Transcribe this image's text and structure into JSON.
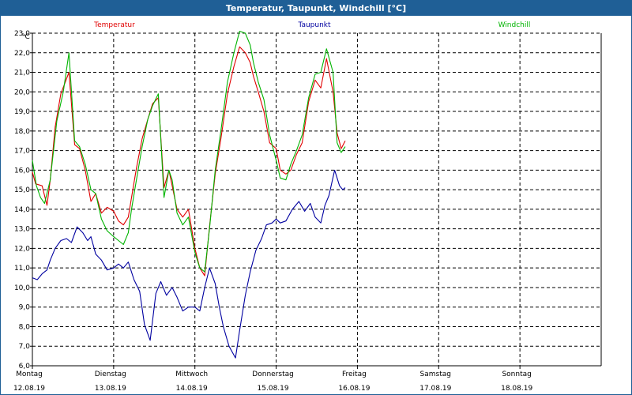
{
  "window": {
    "title": "Temperatur, Taupunkt, Windchill [°C]"
  },
  "chart_data": {
    "type": "line",
    "title": "Temperatur, Taupunkt, Windchill [°C]",
    "ylabel": "°C",
    "ylim": [
      6.0,
      23.0
    ],
    "ytick_step": 1.0,
    "xlim_days": [
      0,
      7
    ],
    "grid": true,
    "legend_placement": "top",
    "y_ticks": [
      "23,0",
      "22,0",
      "21,0",
      "20,0",
      "19,0",
      "18,0",
      "17,0",
      "16,0",
      "15,0",
      "14,0",
      "13,0",
      "12,0",
      "11,0",
      "10,0",
      "9,0",
      "8,0",
      "7,0",
      "6,0"
    ],
    "x_ticks": [
      {
        "day": "Montag",
        "date": "12.08.19"
      },
      {
        "day": "Dienstag",
        "date": "13.08.19"
      },
      {
        "day": "Mittwoch",
        "date": "14.08.19"
      },
      {
        "day": "Donnerstag",
        "date": "15.08.19"
      },
      {
        "day": "Freitag",
        "date": "16.08.19"
      },
      {
        "day": "Samstag",
        "date": "17.08.19"
      },
      {
        "day": "Sonntag",
        "date": "18.08.19"
      }
    ],
    "series": [
      {
        "name": "Temperatur",
        "color": "#e00000",
        "x": [
          0,
          0.04,
          0.12,
          0.18,
          0.22,
          0.28,
          0.35,
          0.45,
          0.52,
          0.58,
          0.65,
          0.72,
          0.78,
          0.85,
          0.92,
          1.0,
          1.06,
          1.12,
          1.18,
          1.22,
          1.28,
          1.35,
          1.42,
          1.48,
          1.55,
          1.62,
          1.68,
          1.72,
          1.78,
          1.85,
          1.92,
          2.0,
          2.06,
          2.12,
          2.18,
          2.25,
          2.32,
          2.4,
          2.48,
          2.55,
          2.62,
          2.68,
          2.72,
          2.78,
          2.85,
          2.92,
          3.0,
          3.05,
          3.12,
          3.18,
          3.25,
          3.32,
          3.4,
          3.48,
          3.55,
          3.62,
          3.7,
          3.75,
          3.8,
          3.85
        ],
        "values": [
          15.9,
          15.3,
          15.2,
          14.2,
          15.5,
          18.2,
          19.9,
          21.0,
          17.3,
          17.1,
          16.0,
          14.4,
          14.8,
          13.8,
          14.1,
          13.9,
          13.4,
          13.2,
          13.6,
          14.6,
          16.1,
          17.6,
          18.6,
          19.4,
          19.7,
          15.1,
          16.0,
          15.2,
          14.0,
          13.6,
          14.0,
          12.0,
          11.0,
          10.6,
          13.1,
          15.8,
          17.6,
          19.9,
          21.3,
          22.3,
          22.0,
          21.5,
          20.8,
          20.0,
          19.0,
          17.4,
          17.1,
          16.0,
          15.8,
          16.0,
          16.8,
          17.4,
          19.5,
          20.6,
          20.2,
          21.7,
          20.0,
          17.9,
          17.1,
          17.5
        ]
      },
      {
        "name": "Taupunkt",
        "color": "#0000a0",
        "x": [
          0,
          0.06,
          0.12,
          0.18,
          0.22,
          0.28,
          0.35,
          0.42,
          0.48,
          0.55,
          0.62,
          0.68,
          0.72,
          0.78,
          0.85,
          0.92,
          1.0,
          1.06,
          1.12,
          1.18,
          1.25,
          1.32,
          1.38,
          1.45,
          1.52,
          1.58,
          1.65,
          1.72,
          1.78,
          1.85,
          1.92,
          2.0,
          2.06,
          2.12,
          2.18,
          2.25,
          2.3,
          2.35,
          2.42,
          2.5,
          2.55,
          2.62,
          2.68,
          2.75,
          2.82,
          2.88,
          2.95,
          3.0,
          3.05,
          3.12,
          3.2,
          3.28,
          3.35,
          3.42,
          3.48,
          3.55,
          3.6,
          3.65,
          3.72,
          3.78,
          3.82,
          3.85
        ],
        "values": [
          10.5,
          10.4,
          10.7,
          10.9,
          11.4,
          12.0,
          12.4,
          12.5,
          12.3,
          13.1,
          12.8,
          12.4,
          12.6,
          11.7,
          11.4,
          10.9,
          11.0,
          11.2,
          11.0,
          11.3,
          10.4,
          9.8,
          8.1,
          7.3,
          9.7,
          10.3,
          9.6,
          10.0,
          9.5,
          8.8,
          9.0,
          9.0,
          8.8,
          10.0,
          11.0,
          10.2,
          9.0,
          8.0,
          7.0,
          6.4,
          7.8,
          9.6,
          10.8,
          11.9,
          12.5,
          13.2,
          13.3,
          13.5,
          13.3,
          13.4,
          14.0,
          14.4,
          13.9,
          14.3,
          13.6,
          13.3,
          14.2,
          14.7,
          16.0,
          15.2,
          15.0,
          15.1
        ]
      },
      {
        "name": "Windchill",
        "color": "#00b400",
        "x": [
          0,
          0.05,
          0.1,
          0.15,
          0.22,
          0.3,
          0.38,
          0.45,
          0.52,
          0.58,
          0.65,
          0.72,
          0.78,
          0.85,
          0.92,
          1.0,
          1.06,
          1.12,
          1.18,
          1.22,
          1.28,
          1.35,
          1.42,
          1.48,
          1.55,
          1.62,
          1.68,
          1.72,
          1.78,
          1.85,
          1.92,
          2.0,
          2.06,
          2.12,
          2.18,
          2.25,
          2.32,
          2.4,
          2.48,
          2.55,
          2.62,
          2.68,
          2.72,
          2.78,
          2.85,
          2.92,
          3.0,
          3.05,
          3.12,
          3.18,
          3.25,
          3.32,
          3.4,
          3.48,
          3.55,
          3.62,
          3.7,
          3.75,
          3.8,
          3.85
        ],
        "values": [
          16.5,
          15.2,
          14.6,
          14.3,
          15.5,
          18.5,
          20.0,
          22.0,
          17.5,
          17.2,
          16.3,
          15.0,
          14.8,
          13.5,
          12.9,
          12.6,
          12.4,
          12.2,
          12.8,
          14.0,
          15.5,
          17.2,
          18.6,
          19.3,
          19.9,
          14.6,
          16.0,
          15.5,
          13.8,
          13.2,
          13.6,
          11.8,
          11.0,
          10.8,
          13.0,
          16.0,
          18.0,
          20.5,
          22.0,
          23.1,
          23.0,
          22.4,
          21.5,
          20.5,
          19.6,
          17.8,
          16.5,
          15.6,
          15.5,
          16.3,
          17.0,
          17.8,
          19.7,
          20.9,
          21.0,
          22.2,
          21.0,
          17.4,
          16.9,
          17.2
        ]
      }
    ]
  }
}
